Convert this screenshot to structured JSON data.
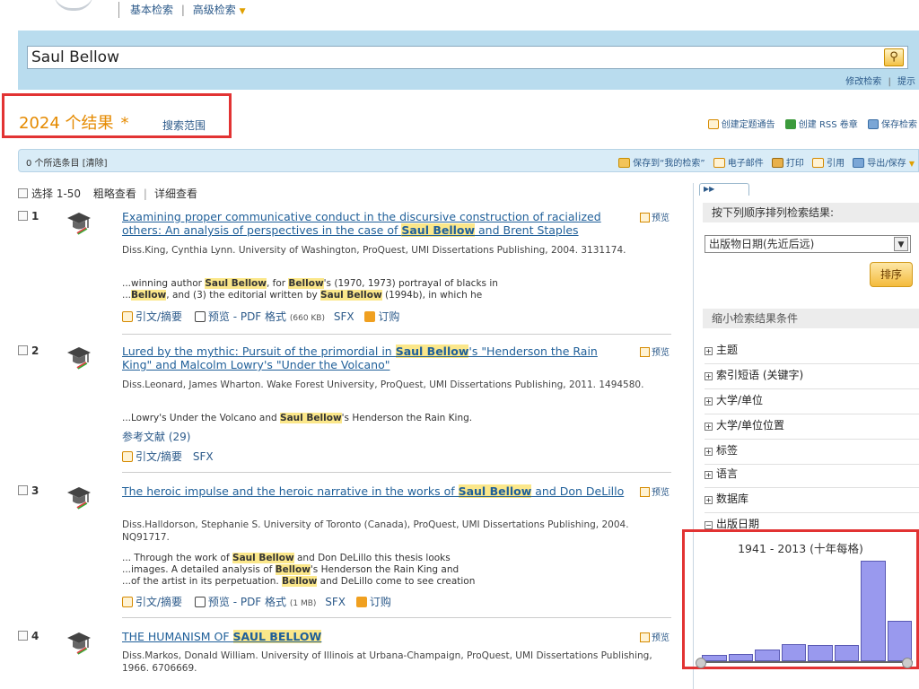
{
  "top": {
    "basic_search": "基本检索",
    "separator": "|",
    "advanced_search": "高级检索"
  },
  "search": {
    "query": "Saul Bellow",
    "modify": "修改检索",
    "sub_sep": "|",
    "tips": "提示"
  },
  "results": {
    "count": "2024 个结果",
    "asterisk": "*",
    "scope": "搜索范围",
    "actions": {
      "alert": "创建定题通告",
      "rss": "创建 RSS 卷章",
      "save": "保存检索"
    }
  },
  "toolbar": {
    "selected": "0 个所选条目 [清除]",
    "save_to_my": "保存到“我的检索”",
    "email": "电子邮件",
    "print": "打印",
    "cite": "引用",
    "export": "导出/保存"
  },
  "select_row": {
    "select_label": "选择 1-50",
    "brief": "粗略查看",
    "sep": "|",
    "detail": "详细查看"
  },
  "preview_label": "预览",
  "items": [
    {
      "num": "1",
      "title_a": "Examining proper communicative conduct in the discursive construction of racialized others: An analysis of perspectives in the case of ",
      "title_hl": "Saul Bellow",
      "title_b": " and Brent Staples",
      "meta": "Diss.King, Cynthia Lynn. University of Washington, ProQuest, UMI Dissertations Publishing, 2004. 3131174.",
      "snippet1_a": "...winning author ",
      "snippet1_hl1": "Saul Bellow",
      "snippet1_b": ", for ",
      "snippet1_hl2": "Bellow",
      "snippet1_c": "'s (1970, 1973) portrayal of blacks in",
      "snippet2_a": "...",
      "snippet2_hl1": "Bellow",
      "snippet2_b": ", and (3) the editorial written by ",
      "snippet2_hl2": "Saul Bellow",
      "snippet2_c": " (1994b), in which he",
      "link_cite": "引文/摘要",
      "link_pdf": "预览 - PDF 格式",
      "pdf_size": "(660 KB)",
      "link_sfx": "SFX",
      "link_order": "订购"
    },
    {
      "num": "2",
      "title_a": "Lured by the mythic: Pursuit of the primordial in ",
      "title_hl": "Saul Bellow",
      "title_b": "'s \"Henderson the Rain King\" and Malcolm Lowry's \"Under the Volcano\"",
      "meta": "Diss.Leonard, James Wharton. Wake Forest University, ProQuest, UMI Dissertations Publishing, 2011. 1494580.",
      "snippet1_a": "...Lowry's Under the Volcano and ",
      "snippet1_hl1": "Saul Bellow",
      "snippet1_b": "'s Henderson the Rain King.",
      "refs": "参考文献 (29)",
      "link_cite": "引文/摘要",
      "link_sfx": "SFX"
    },
    {
      "num": "3",
      "title_a": "The heroic impulse and the heroic narrative in the works of ",
      "title_hl": "Saul Bellow",
      "title_b": " and Don DeLillo",
      "meta": "Diss.Halldorson, Stephanie S. University of Toronto (Canada), ProQuest, UMI Dissertations Publishing, 2004. NQ91717.",
      "snippet1_a": "... Through the work of ",
      "snippet1_hl1": "Saul Bellow",
      "snippet1_b": " and Don DeLillo this thesis looks",
      "snippet2_a": "...images. A detailed analysis of ",
      "snippet2_hl1": "Bellow",
      "snippet2_b": "'s Henderson the Rain King and",
      "snippet3_a": "...of the artist in its perpetuation. ",
      "snippet3_hl1": "Bellow",
      "snippet3_b": " and DeLillo come to see creation",
      "link_cite": "引文/摘要",
      "link_pdf": "预览 - PDF 格式",
      "pdf_size": "(1 MB)",
      "link_sfx": "SFX",
      "link_order": "订购"
    },
    {
      "num": "4",
      "title_a": "THE HUMANISM OF ",
      "title_hl": "SAUL BELLOW",
      "title_b": "",
      "meta": "Diss.Markos, Donald William. University of Illinois at Urbana-Champaign, ProQuest, UMI Dissertations Publishing, 1966. 6706669."
    }
  ],
  "sidebar": {
    "tab": "▶▶",
    "sort_head": "按下列顺序排列检索结果:",
    "sort_value": "出版物日期(先近后远)",
    "sort_button": "排序",
    "narrow_head": "缩小检索结果条件",
    "facets": [
      {
        "sign": "+",
        "label": "主题"
      },
      {
        "sign": "+",
        "label": "索引短语 (关键字)"
      },
      {
        "sign": "+",
        "label": "大学/单位"
      },
      {
        "sign": "+",
        "label": "大学/单位位置"
      },
      {
        "sign": "+",
        "label": "标签"
      },
      {
        "sign": "+",
        "label": "语言"
      },
      {
        "sign": "+",
        "label": "数据库"
      },
      {
        "sign": "−",
        "label": "出版日期"
      }
    ],
    "histogram": {
      "title": "1941 - 2013 (十年每格)",
      "bars": [
        0.06,
        0.07,
        0.12,
        0.17,
        0.16,
        0.16,
        1.0,
        0.4
      ]
    }
  },
  "colors": {
    "accent": "#e58a00",
    "link": "#1f5f99",
    "highlight": "#fbe78a",
    "band": "#b9dcee",
    "bar": "#9999ee",
    "callout": "#e23333"
  }
}
